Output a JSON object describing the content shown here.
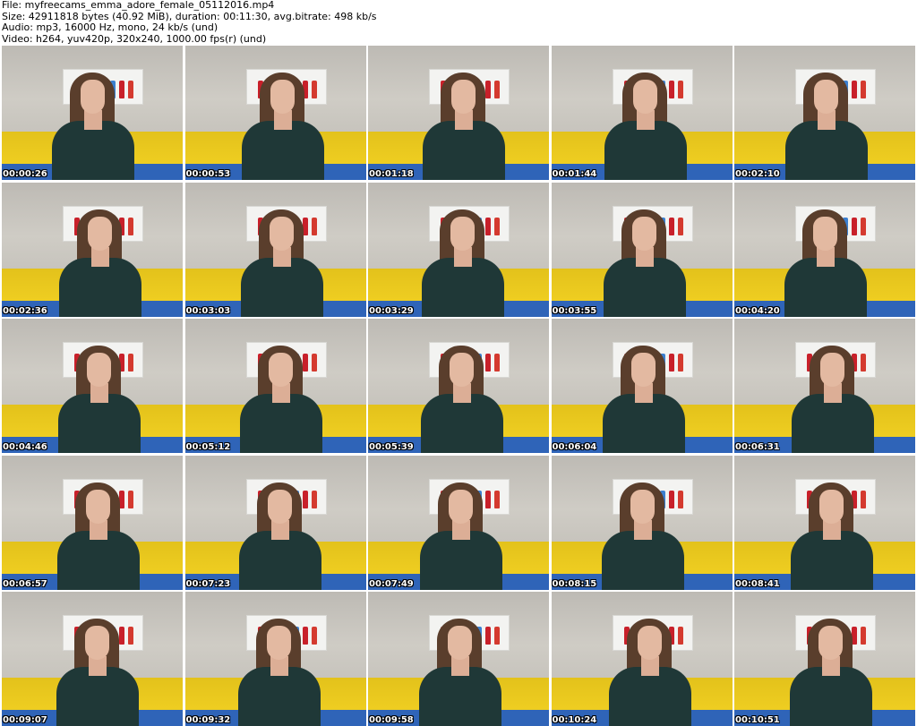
{
  "header": {
    "file_line": "File: myfreecams_emma_adore_female_05112016.mp4",
    "size_line": "Size: 42911818 bytes (40.92 MiB), duration: 00:11:30, avg.bitrate: 498 kb/s",
    "audio_line": "Audio: mp3, 16000 Hz, mono, 24 kb/s (und)",
    "video_line": "Video: h264, yuv420p, 320x240, 1000.00 fps(r) (und)"
  },
  "thumbnails": [
    {
      "timestamp": "00:00:26"
    },
    {
      "timestamp": "00:00:53"
    },
    {
      "timestamp": "00:01:18"
    },
    {
      "timestamp": "00:01:44"
    },
    {
      "timestamp": "00:02:10"
    },
    {
      "timestamp": "00:02:36"
    },
    {
      "timestamp": "00:03:03"
    },
    {
      "timestamp": "00:03:29"
    },
    {
      "timestamp": "00:03:55"
    },
    {
      "timestamp": "00:04:20"
    },
    {
      "timestamp": "00:04:46"
    },
    {
      "timestamp": "00:05:12"
    },
    {
      "timestamp": "00:05:39"
    },
    {
      "timestamp": "00:06:04"
    },
    {
      "timestamp": "00:06:31"
    },
    {
      "timestamp": "00:06:57"
    },
    {
      "timestamp": "00:07:23"
    },
    {
      "timestamp": "00:07:49"
    },
    {
      "timestamp": "00:08:15"
    },
    {
      "timestamp": "00:08:41"
    },
    {
      "timestamp": "00:09:07"
    },
    {
      "timestamp": "00:09:32"
    },
    {
      "timestamp": "00:09:58"
    },
    {
      "timestamp": "00:10:24"
    },
    {
      "timestamp": "00:10:51"
    }
  ],
  "colors": {
    "wall": "#c9c6bf",
    "couch_yellow": "#f0cf22",
    "couch_blue": "#2f64b8",
    "shirt": "#1f3837",
    "hair": "#5a3e2c",
    "timestamp_text": "#ffffff"
  }
}
